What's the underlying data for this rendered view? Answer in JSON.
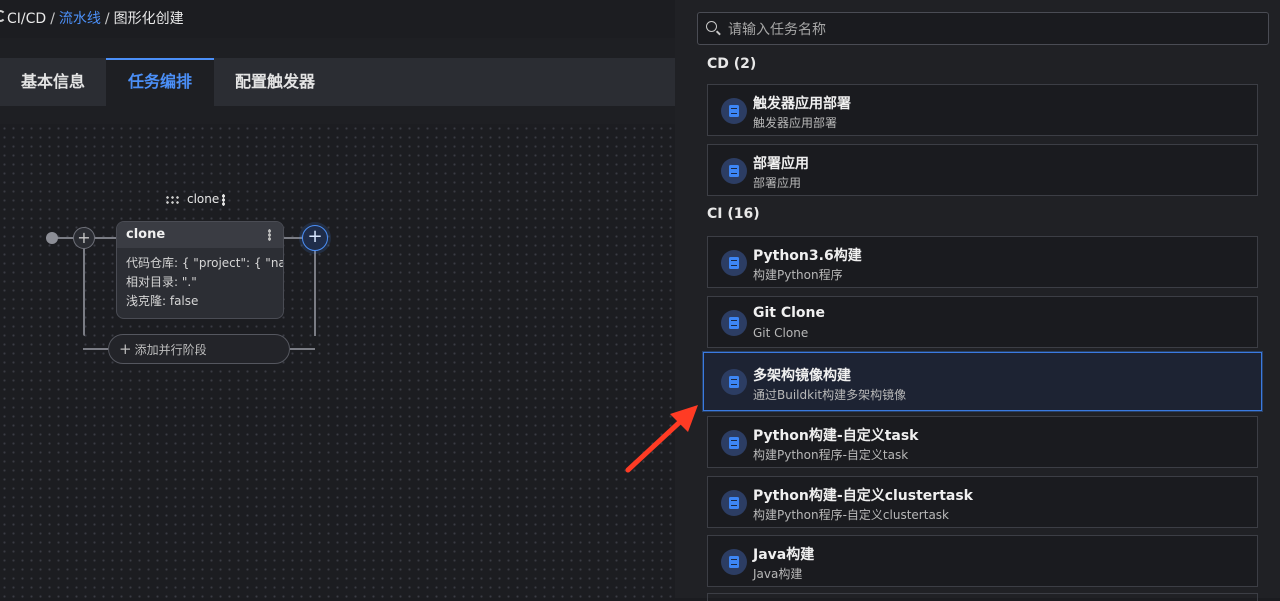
{
  "breadcrumb": {
    "root": "CI/CD",
    "sep": "/",
    "pipeline": "流水线",
    "current": "图形化创建"
  },
  "tabs": [
    {
      "label": "基本信息",
      "active": false
    },
    {
      "label": "任务编排",
      "active": true
    },
    {
      "label": "配置触发器",
      "active": false
    }
  ],
  "canvas": {
    "stage_name": "clone",
    "task": {
      "name": "clone",
      "lines": [
        "代码仓库: { \"project\": { \"na",
        "相对目录: \".\"",
        "浅克隆: false"
      ]
    },
    "add_parallel": "添加并行阶段",
    "plus": "+"
  },
  "panel": {
    "search_placeholder": "请输入任务名称",
    "sections": [
      {
        "title": "CD (2)",
        "items": [
          {
            "title": "触发器应用部署",
            "subtitle": "触发器应用部署"
          },
          {
            "title": "部署应用",
            "subtitle": "部署应用"
          }
        ]
      },
      {
        "title": "CI (16)",
        "items": [
          {
            "title": "Python3.6构建",
            "subtitle": "构建Python程序"
          },
          {
            "title": "Git Clone",
            "subtitle": "Git Clone"
          },
          {
            "title": "多架构镜像构建",
            "subtitle": "通过Buildkit构建多架构镜像",
            "selected": true
          },
          {
            "title": "Python构建-自定义task",
            "subtitle": "构建Python程序-自定义task"
          },
          {
            "title": "Python构建-自定义clustertask",
            "subtitle": "构建Python程序-自定义clustertask"
          },
          {
            "title": "Java构建",
            "subtitle": "Java构建"
          }
        ]
      }
    ]
  },
  "colors": {
    "accent": "#4b8ff7",
    "annotation_arrow": "#ff3b24"
  }
}
